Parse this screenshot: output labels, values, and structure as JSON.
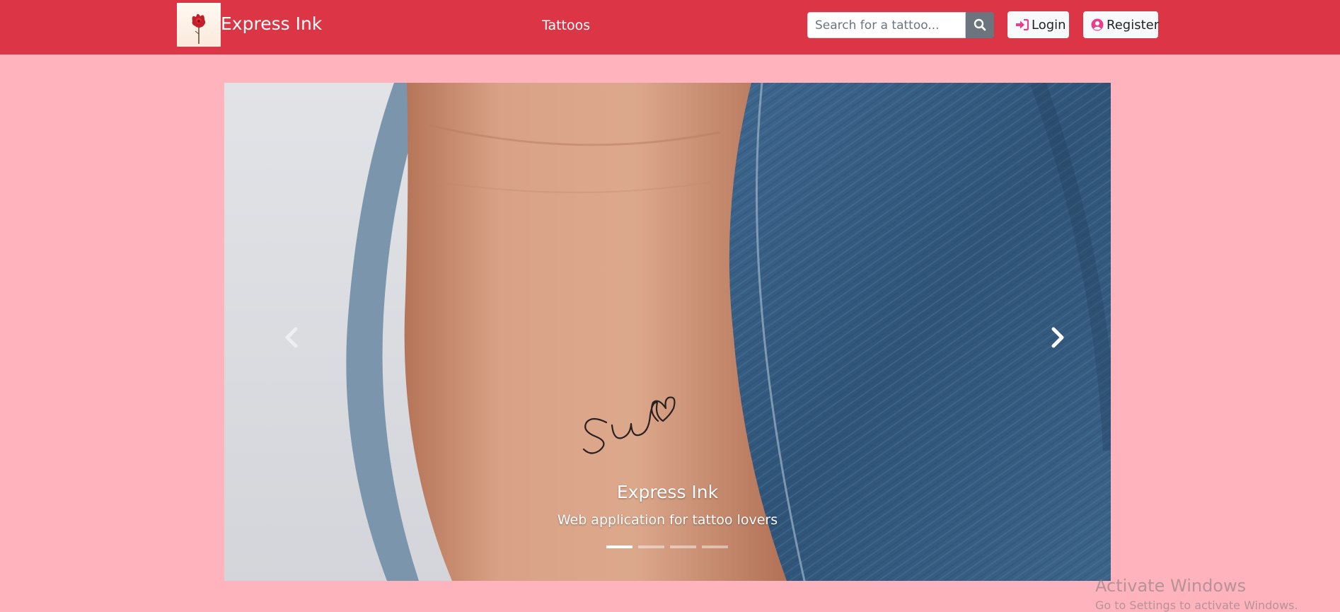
{
  "navbar": {
    "brand_name": "Express Ink",
    "nav_link": "Tattoos",
    "search_placeholder": "Search for a tattoo...",
    "login_label": "Login",
    "register_label": "Register",
    "background_color": "#dc3545"
  },
  "carousel": {
    "caption_title": "Express Ink",
    "caption_text": "Web application for tattoo lovers",
    "slide_count": 4,
    "active_slide": 1
  },
  "watermark": {
    "title": "Activate Windows",
    "subtitle": "Go to Settings to activate Windows."
  },
  "icons": [
    "flower-logo",
    "search-icon",
    "sign-in-icon",
    "user-circle-icon",
    "chevron-left-icon",
    "chevron-right-icon"
  ],
  "colors": {
    "page_background": "#ffb3bd",
    "accent_red": "#dc3545",
    "search_button": "#6c757d",
    "icon_pink": "#e83e8c"
  }
}
